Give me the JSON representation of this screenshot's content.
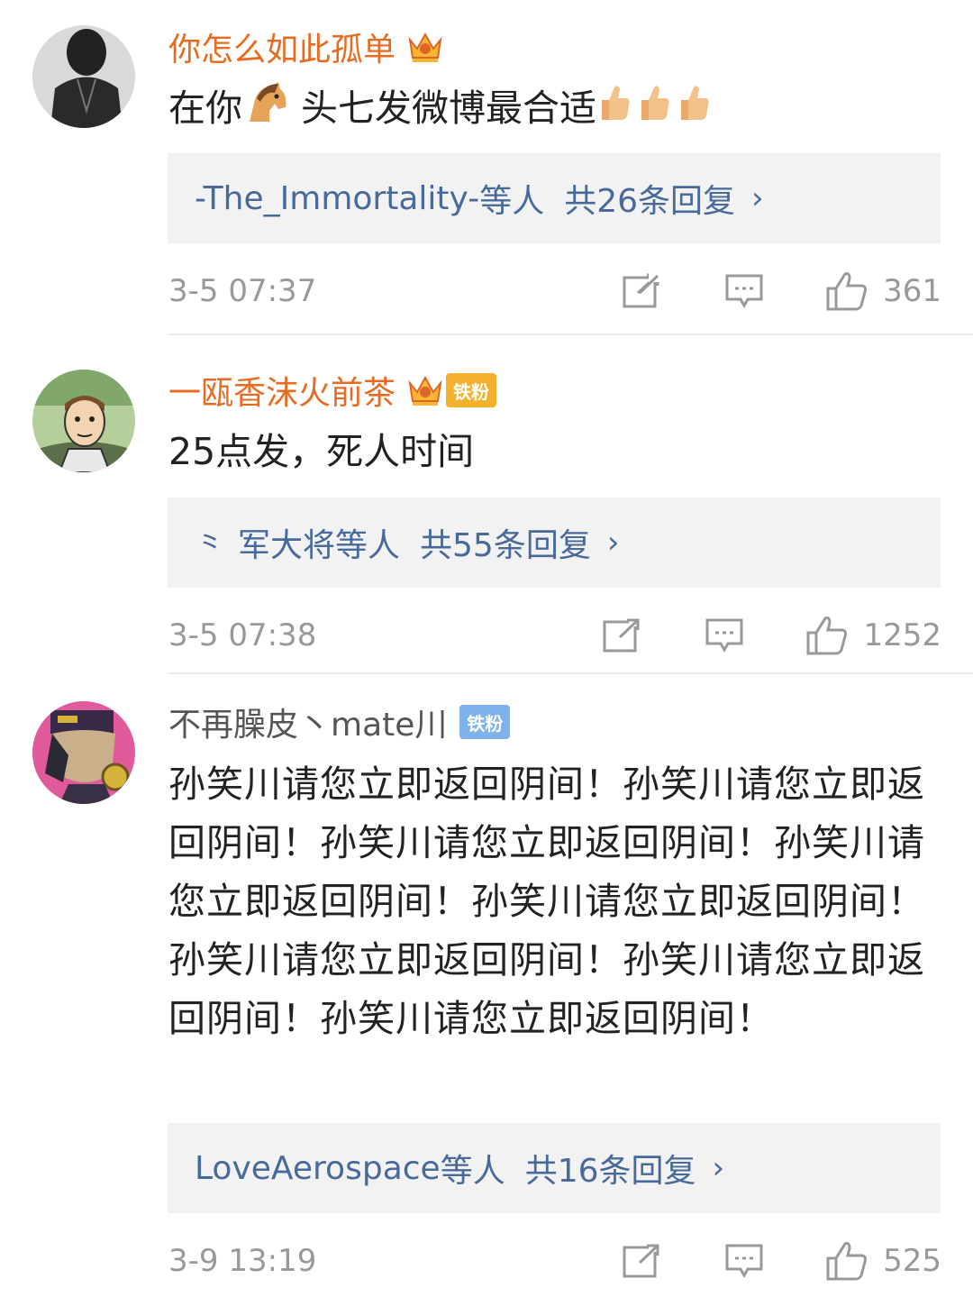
{
  "comments": [
    {
      "username": "你怎么如此孤单",
      "text_before_emoji": "在你",
      "text_after_emoji": " 头七发微博最合适",
      "reply_users": "-The_Immortality-",
      "reply_suffix": "等人",
      "reply_count_text": "共26条回复",
      "time": "3-5 07:37",
      "likes": "361"
    },
    {
      "username": "一瓯香沫火前茶",
      "badge": "铁粉",
      "text": "25点发，死人时间",
      "reply_users": "军大将",
      "reply_suffix": "等人",
      "reply_count_text": "共55条回复",
      "time": "3-5 07:38",
      "likes": "1252"
    },
    {
      "username": "不再臊皮丶mate川",
      "badge": "铁粉",
      "text": "孙笑川请您立即返回阴间！孙笑川请您立即返回阴间！孙笑川请您立即返回阴间！孙笑川请您立即返回阴间！孙笑川请您立即返回阴间！孙笑川请您立即返回阴间！孙笑川请您立即返回阴间！孙笑川请您立即返回阴间！",
      "reply_users": "LoveAerospace",
      "reply_suffix": "等人",
      "reply_count_text": "共16条回复",
      "time": "3-9 13:19",
      "likes": "525"
    }
  ],
  "icons": {
    "vip_crown": "crown-icon",
    "horse": "horse-emoji-icon",
    "thumbs": "thumbs-up-emoji-icon",
    "repost": "repost-icon",
    "comment": "comment-icon",
    "like": "like-icon",
    "chevron": "chevron-right-icon"
  },
  "colors": {
    "vip_name": "#e86b22",
    "reply_link": "#486a9a",
    "meta_gray": "#999999",
    "badge_gold": "#f3b12d",
    "badge_blue": "#7fb2ea"
  }
}
